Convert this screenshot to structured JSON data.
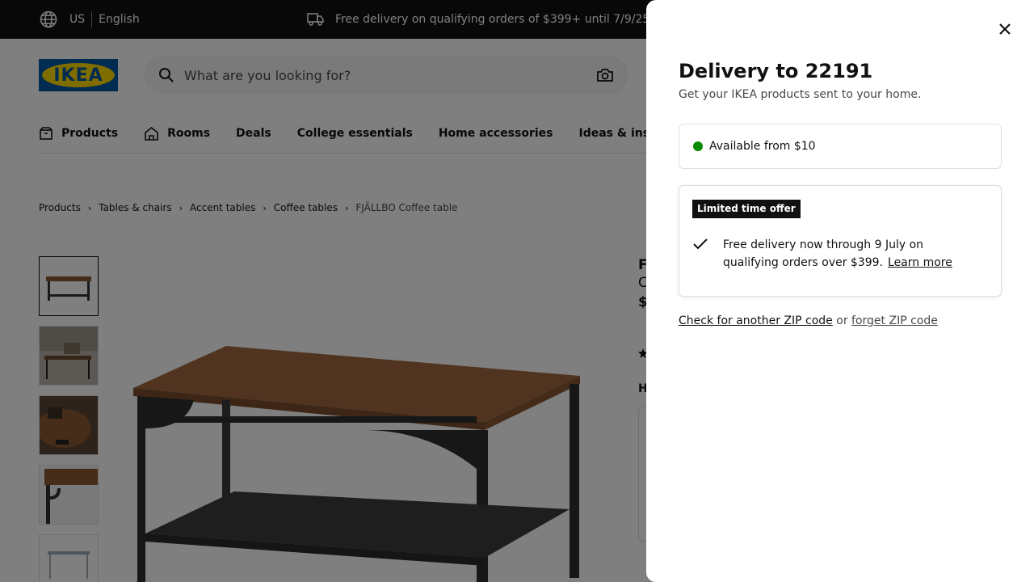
{
  "topbar": {
    "country": "US",
    "language": "English",
    "promo": "Free delivery on qualifying orders of $399+ until 7/9/25*"
  },
  "header": {
    "logo_text": "IKEA",
    "search_placeholder": "What are you looking for?"
  },
  "nav": {
    "items": [
      "Products",
      "Rooms",
      "Deals",
      "College essentials",
      "Home accessories",
      "Ideas & inspira"
    ]
  },
  "breadcrumb": [
    "Products",
    "Tables & chairs",
    "Accent tables",
    "Coffee tables",
    "FJÄLLBO Coffee table"
  ],
  "product_partial": {
    "name_fragment": "F",
    "sub_fragment": "C",
    "price_fragment": "$",
    "label_fragment": "H"
  },
  "panel": {
    "title": "Delivery to 22191",
    "subtitle": "Get your IKEA products sent to your home.",
    "availability": "Available from $10",
    "availability_color": "#0a8a00",
    "offer_badge": "Limited time offer",
    "offer_text": "Free delivery now through 9 July on qualifying orders over $399.",
    "offer_link": "Learn more",
    "zip_check_link": "Check for another ZIP code",
    "zip_or": "or",
    "zip_forget_link": "forget ZIP code"
  }
}
